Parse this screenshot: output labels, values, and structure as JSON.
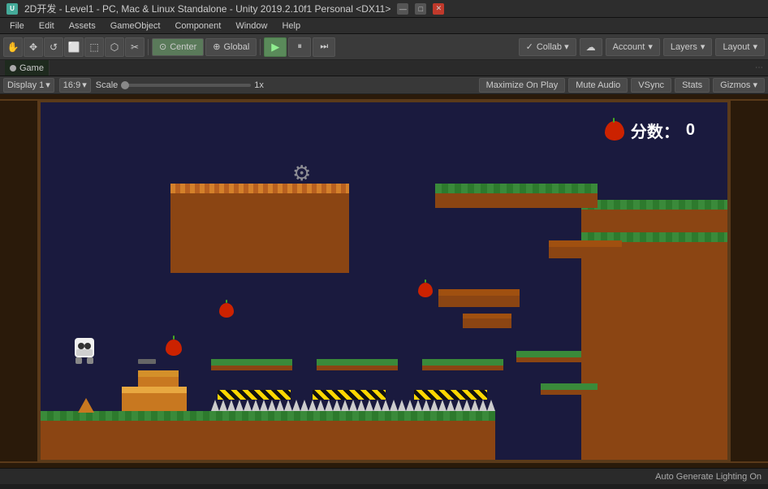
{
  "titlebar": {
    "text": "2D开发 - Level1 - PC, Mac & Linux Standalone - Unity 2019.2.10f1 Personal <DX11>",
    "minimize": "—",
    "maximize": "□",
    "close": "✕"
  },
  "menubar": {
    "items": [
      "File",
      "Edit",
      "Assets",
      "GameObject",
      "Component",
      "Window",
      "Help"
    ]
  },
  "toolbar": {
    "tools": [
      "⊕",
      "✥",
      "↺",
      "⬜",
      "⬚",
      "⬡",
      "✂"
    ],
    "pivot_label": "Center",
    "pivot_icon": "⊙",
    "global_label": "Global",
    "global_icon": "⊕",
    "play_icon": "▶",
    "pause_icon": "⏸",
    "step_icon": "⏭",
    "collab_label": "Collab ▾",
    "collab_check": "✓",
    "cloud_icon": "☁",
    "account_label": "Account",
    "layers_label": "Layers",
    "layout_label": "Layout"
  },
  "game_view": {
    "tab_label": "Game",
    "display_label": "Display 1",
    "aspect_label": "16:9",
    "scale_label": "Scale",
    "scale_value": "1x",
    "maximize_btn": "Maximize On Play",
    "mute_btn": "Mute Audio",
    "vsync_btn": "VSync",
    "stats_btn": "Stats",
    "gizmos_btn": "Gizmos ▾"
  },
  "score": {
    "label": "分数：",
    "value": "0"
  },
  "status_bar": {
    "text": "Auto Generate Lighting On"
  }
}
